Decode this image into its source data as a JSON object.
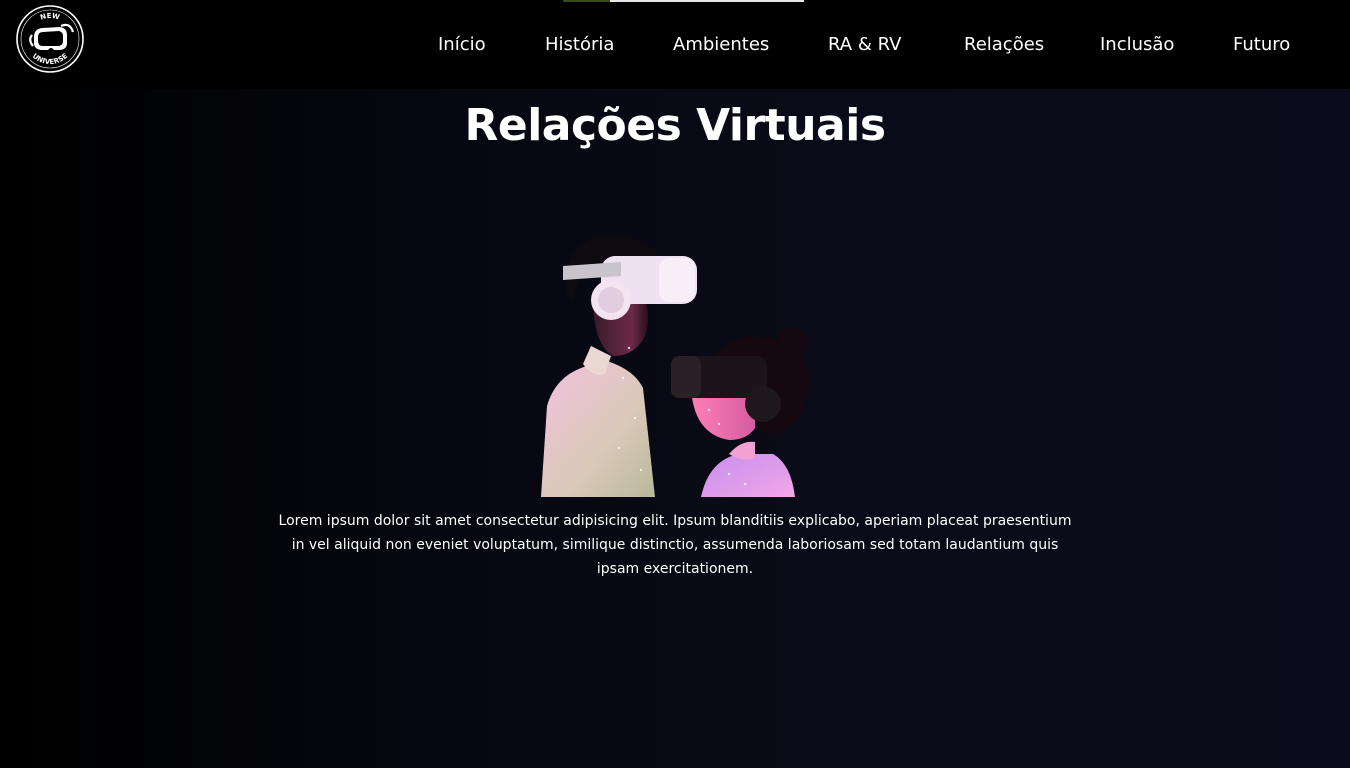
{
  "header": {
    "logo_text_top": "NEW",
    "logo_text_bottom": "UNIVERSE",
    "nav": [
      {
        "label": "Início"
      },
      {
        "label": "História"
      },
      {
        "label": "Ambientes"
      },
      {
        "label": "RA & RV"
      },
      {
        "label": "Relações"
      },
      {
        "label": "Inclusão"
      },
      {
        "label": "Futuro"
      }
    ]
  },
  "main": {
    "title": "Relações Virtuais",
    "paragraph": "Lorem ipsum dolor sit amet consectetur adipisicing elit. Ipsum blanditiis explicabo, aperiam placeat praesentium in vel aliquid non eveniet voluptatum, similique distinctio, assumenda laboriosam sed totam laudantium quis ipsam exercitationem."
  },
  "colors": {
    "header_bg": "#000000",
    "page_bg": "#0b0c1b",
    "text": "#ffffff",
    "accent_pink": "#e86ad8"
  }
}
